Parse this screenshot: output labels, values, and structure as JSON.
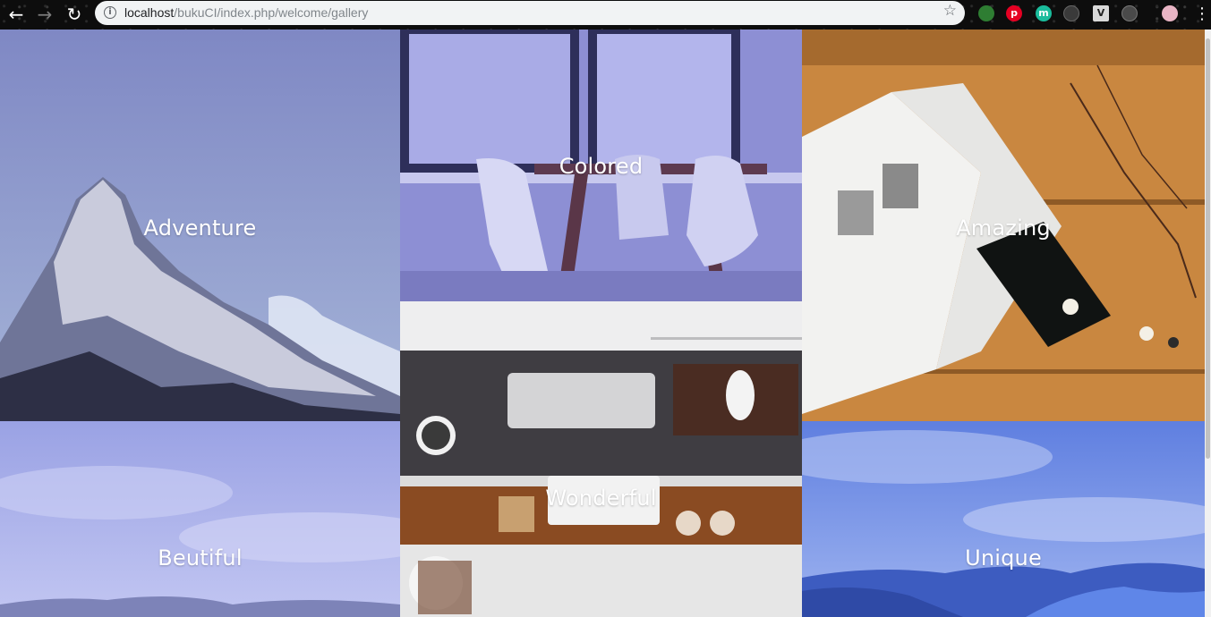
{
  "browser": {
    "url_host": "localhost",
    "url_path": "/bukuCI/index.php/welcome/gallery",
    "back_icon": "arrow-left",
    "forward_icon": "arrow-right",
    "reload_icon": "reload",
    "info_icon": "info-circle",
    "bookmark_icon": "star-outline",
    "menu_icon": "vertical-dots",
    "extensions": [
      {
        "name": "globe-extension-icon",
        "label": "",
        "color": "#2e7d32"
      },
      {
        "name": "pinterest-extension-icon",
        "label": "p",
        "color": "#e60023"
      },
      {
        "name": "m-extension-icon",
        "label": "m",
        "color": "#1abc9c"
      },
      {
        "name": "circle-extension-icon",
        "label": "",
        "color": "#3a3a3a"
      },
      {
        "name": "v-extension-icon",
        "label": "V",
        "color": "#d9d9d9"
      },
      {
        "name": "gear-extension-icon",
        "label": "",
        "color": "#4a4a4a"
      },
      {
        "name": "profile-avatar",
        "label": "",
        "color": "#e8b4c4"
      }
    ]
  },
  "gallery": {
    "tiles": [
      {
        "id": "adventure",
        "caption": "Adventure",
        "tint": "#7f86c8"
      },
      {
        "id": "colored",
        "caption": "Colored",
        "tint": "#8d8fd6"
      },
      {
        "id": "amazing",
        "caption": "Amazing",
        "tint": "#c98740"
      },
      {
        "id": "beutiful",
        "caption": "Beutiful",
        "tint": "#a9b0ea"
      },
      {
        "id": "wonderful",
        "caption": "Wonderful",
        "tint": "#6c5a4a"
      },
      {
        "id": "unique",
        "caption": "Unique",
        "tint": "#6f8fe6"
      }
    ]
  }
}
